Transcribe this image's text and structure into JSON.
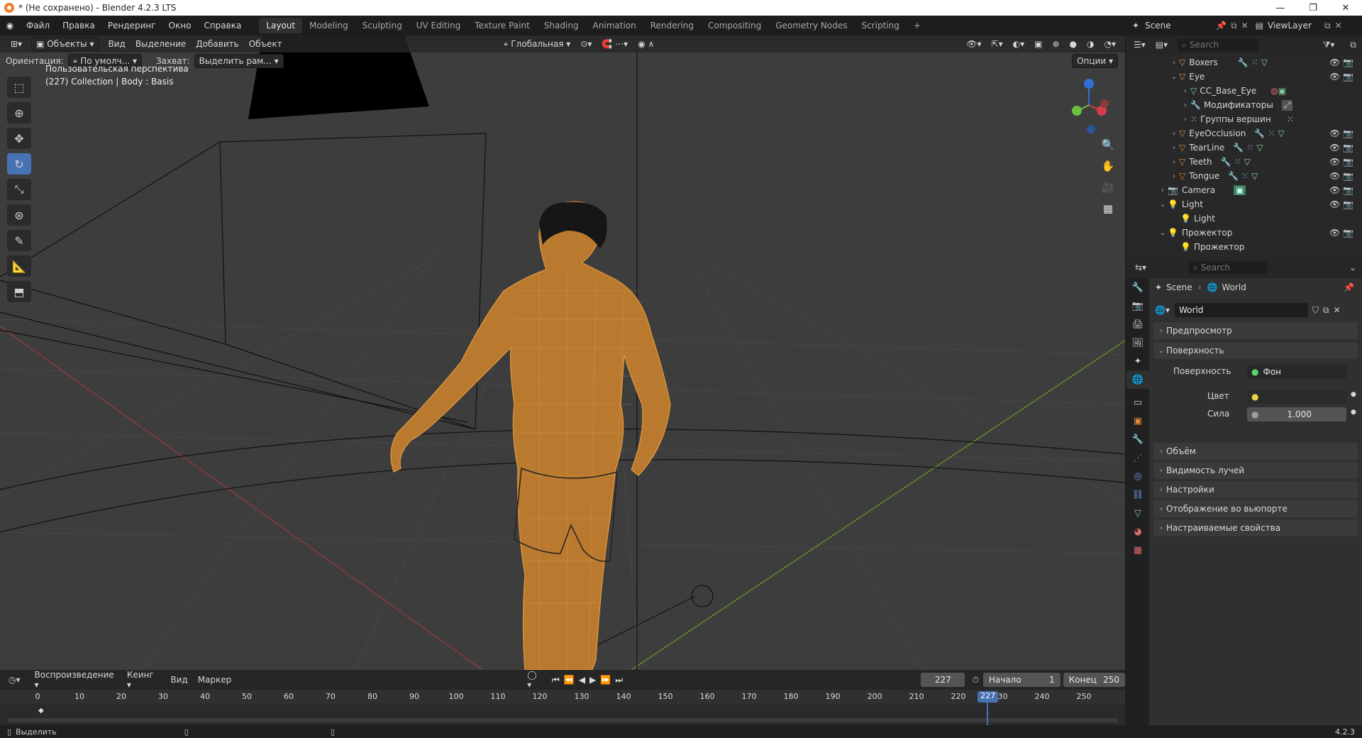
{
  "window": {
    "title": "* (Не сохранено) - Blender 4.2.3 LTS"
  },
  "menu": [
    "Файл",
    "Правка",
    "Рендеринг",
    "Окно",
    "Справка"
  ],
  "workspaces": [
    "Layout",
    "Modeling",
    "Sculpting",
    "UV Editing",
    "Texture Paint",
    "Shading",
    "Animation",
    "Rendering",
    "Compositing",
    "Geometry Nodes",
    "Scripting"
  ],
  "active_workspace": "Layout",
  "scene": {
    "name": "Scene",
    "view_layer": "ViewLayer"
  },
  "viewport": {
    "mode": "Объекты",
    "header_menu": [
      "Вид",
      "Выделение",
      "Добавить",
      "Объект"
    ],
    "transform_orientation": "Глобальная",
    "orientation_label": "Ориентация:",
    "orientation_value": "По умолч...",
    "snap_label": "Захват:",
    "snap_value": "Выделить рам...",
    "options_label": "Опции",
    "info_line1": "Пользовательская перспектива",
    "info_line2": "(227) Collection | Body : Basis"
  },
  "outliner": {
    "search_placeholder": "Search",
    "rows": [
      {
        "label": "Boxers",
        "indent": 1,
        "type": "mesh",
        "expanded": false,
        "vis": true
      },
      {
        "label": "Eye",
        "indent": 1,
        "type": "mesh",
        "expanded": true,
        "vis": true
      },
      {
        "label": "CC_Base_Eye",
        "indent": 2,
        "type": "mesh-data",
        "expanded": false,
        "vis": false
      },
      {
        "label": "Модификаторы",
        "indent": 2,
        "type": "modifier",
        "expanded": false,
        "vis": false
      },
      {
        "label": "Группы вершин",
        "indent": 2,
        "type": "vgroup",
        "expanded": false,
        "vis": false
      },
      {
        "label": "EyeOcclusion",
        "indent": 1,
        "type": "mesh",
        "expanded": false,
        "vis": true
      },
      {
        "label": "TearLine",
        "indent": 1,
        "type": "mesh",
        "expanded": false,
        "vis": true
      },
      {
        "label": "Teeth",
        "indent": 1,
        "type": "mesh",
        "expanded": false,
        "vis": true
      },
      {
        "label": "Tongue",
        "indent": 1,
        "type": "mesh",
        "expanded": false,
        "vis": true
      },
      {
        "label": "Camera",
        "indent": 0,
        "type": "camera",
        "expanded": false,
        "vis": true
      },
      {
        "label": "Light",
        "indent": 0,
        "type": "light",
        "expanded": true,
        "vis": true
      },
      {
        "label": "Light",
        "indent": 1,
        "type": "light-data",
        "expanded": false,
        "vis": false
      },
      {
        "label": "Прожектор",
        "indent": 0,
        "type": "light",
        "expanded": true,
        "vis": true
      },
      {
        "label": "Прожектор",
        "indent": 1,
        "type": "light-data",
        "expanded": false,
        "vis": false
      }
    ]
  },
  "properties": {
    "search_placeholder": "Search",
    "breadcrumb": [
      "Scene",
      "World"
    ],
    "world_name": "World",
    "panels": [
      "Предпросмотр",
      "Поверхность",
      "Объём",
      "Видимость лучей",
      "Настройки",
      "Отображение во вьюпорте",
      "Настраиваемые свойства"
    ],
    "surface_label": "Поверхность",
    "surface_value": "Фон",
    "color_label": "Цвет",
    "strength_label": "Сила",
    "strength_value": "1.000"
  },
  "timeline": {
    "menu": [
      "Воспроизведение",
      "Кеинг",
      "Вид",
      "Маркер"
    ],
    "current_frame": "227",
    "start_label": "Начало",
    "start_value": "1",
    "end_label": "Конец",
    "end_value": "250",
    "ticks": [
      "0",
      "10",
      "20",
      "30",
      "40",
      "50",
      "60",
      "70",
      "80",
      "90",
      "100",
      "110",
      "120",
      "130",
      "140",
      "150",
      "160",
      "170",
      "180",
      "190",
      "200",
      "210",
      "220",
      "230",
      "240",
      "250"
    ],
    "playhead_label": "227"
  },
  "status": {
    "left": "Выделить",
    "version": "4.2.3"
  }
}
